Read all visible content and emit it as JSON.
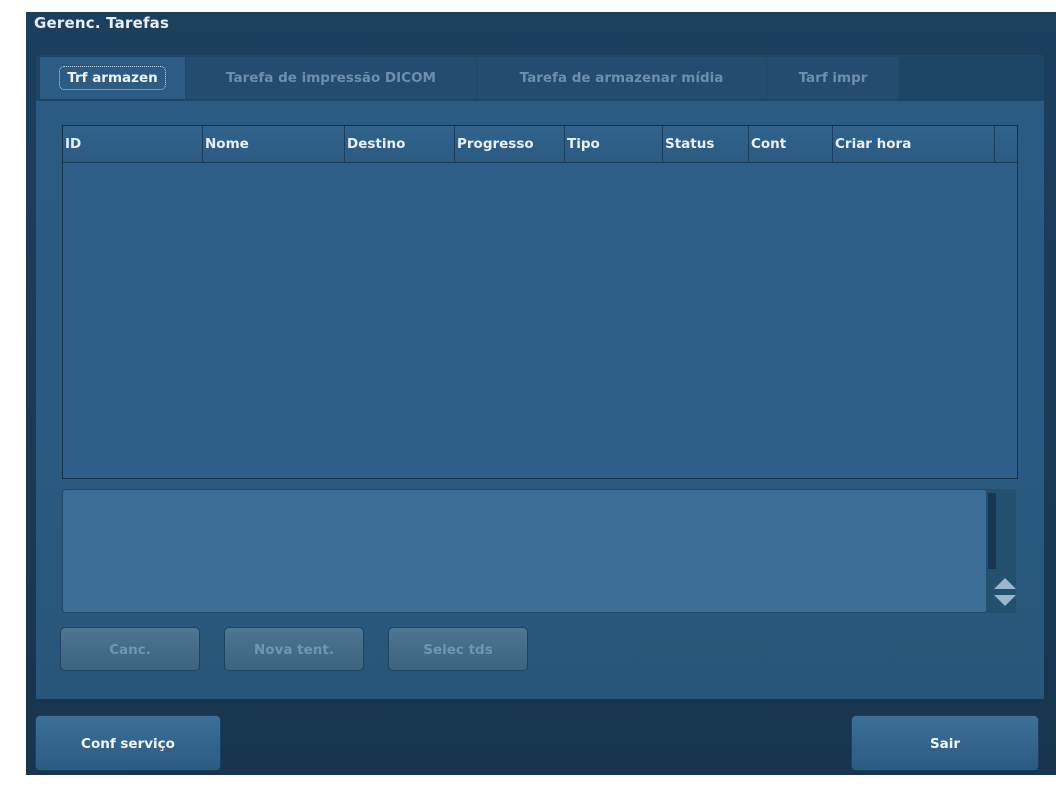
{
  "dialog": {
    "title": "Gerenc. Tarefas"
  },
  "tabs": [
    {
      "label": "Trf armazen",
      "active": true
    },
    {
      "label": "Tarefa de impressão DICOM",
      "active": false
    },
    {
      "label": "Tarefa de armazenar mídia",
      "active": false
    },
    {
      "label": "Tarf impr",
      "active": false
    }
  ],
  "table": {
    "columns": [
      "ID",
      "Nome",
      "Destino",
      "Progresso",
      "Tipo",
      "Status",
      "Cont",
      "Criar hora"
    ],
    "rows": []
  },
  "message": {
    "text": ""
  },
  "actions": {
    "cancel_label": "Canc.",
    "retry_label": "Nova tent.",
    "select_all_label": "Selec tds"
  },
  "footer": {
    "service_label": "Conf serviço",
    "exit_label": "Sair"
  },
  "colors": {
    "dialog_bg": "#1c3f5e",
    "panel_bg": "#2b5b83",
    "text": "#e9eff4",
    "disabled_text": "#6f95b1"
  }
}
